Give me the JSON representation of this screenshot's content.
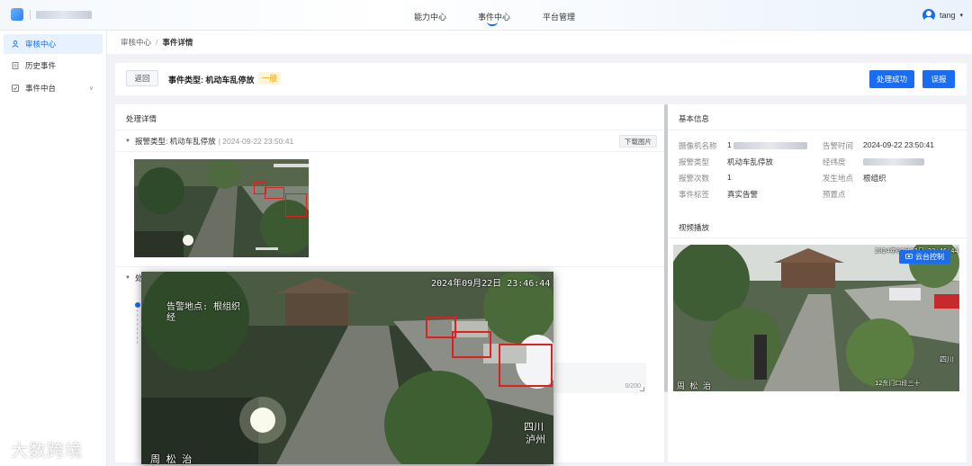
{
  "header": {
    "nav_items": [
      "能力中心",
      "事件中心",
      "平台管理"
    ],
    "active_nav": "事件中心",
    "username": "tang",
    "caret": "▾"
  },
  "sidebar": {
    "items": [
      {
        "label": "审核中心",
        "icon": "user-icon",
        "active": true
      },
      {
        "label": "历史事件",
        "icon": "document-icon",
        "active": false
      },
      {
        "label": "事件中台",
        "icon": "checkbox-icon",
        "active": false,
        "chevron": "∨"
      }
    ],
    "watermark": "大数跨境"
  },
  "breadcrumb": {
    "parent": "审核中心",
    "separator": "/",
    "current": "事件详情"
  },
  "event_header": {
    "back_label": "返回",
    "event_type": "事件类型: 机动车乱停放",
    "level_tag": "一般",
    "level_tag_color": "#e6a200",
    "action_success_label": "处理成功",
    "action_report_label": "误报"
  },
  "processing": {
    "title": "处理详情",
    "alarm_row": {
      "toggle": "▼",
      "text": "报警类型: 机动车乱停放",
      "time": "| 2024-09-22 23:50:41",
      "download_label": "下载图片"
    },
    "second_row": {
      "toggle": "▼",
      "text": "处"
    },
    "textarea": {
      "count": "0/200"
    }
  },
  "basic_info": {
    "title": "基本信息",
    "rows": [
      {
        "k1": "摄像机名称",
        "v1": "1",
        "k2": "告警时间",
        "v2": "2024-09-22 23:50:41"
      },
      {
        "k1": "报警类型",
        "v1": "机动车乱停放",
        "k2": "经纬度",
        "v2": ""
      },
      {
        "k1": "报警次数",
        "v1": "1",
        "k2": "发生地点",
        "v2": "根组织"
      },
      {
        "k1": "事件标签",
        "v1": "真实告警",
        "k2": "预置点",
        "v2": ""
      }
    ]
  },
  "video": {
    "title": "视频播放",
    "ptz_label": "云台控制",
    "overlay_time": "2024年09月22日 23:46:44",
    "overlay_bottom_left": "周 松 治",
    "overlay_bottom_right": "12东门口段三十",
    "overlay_right_text": "四川"
  },
  "photo_overlay": {
    "timestamp": "2024年09月22日 23:46:44",
    "location": "告警地点: 根组织",
    "location_line2": "经",
    "bottom_left": "周 松 治",
    "bottom_right_1": "四川",
    "bottom_right_2": "泸州"
  },
  "colors": {
    "primary": "#1a6cf0",
    "alarm_box": "#e02020"
  }
}
